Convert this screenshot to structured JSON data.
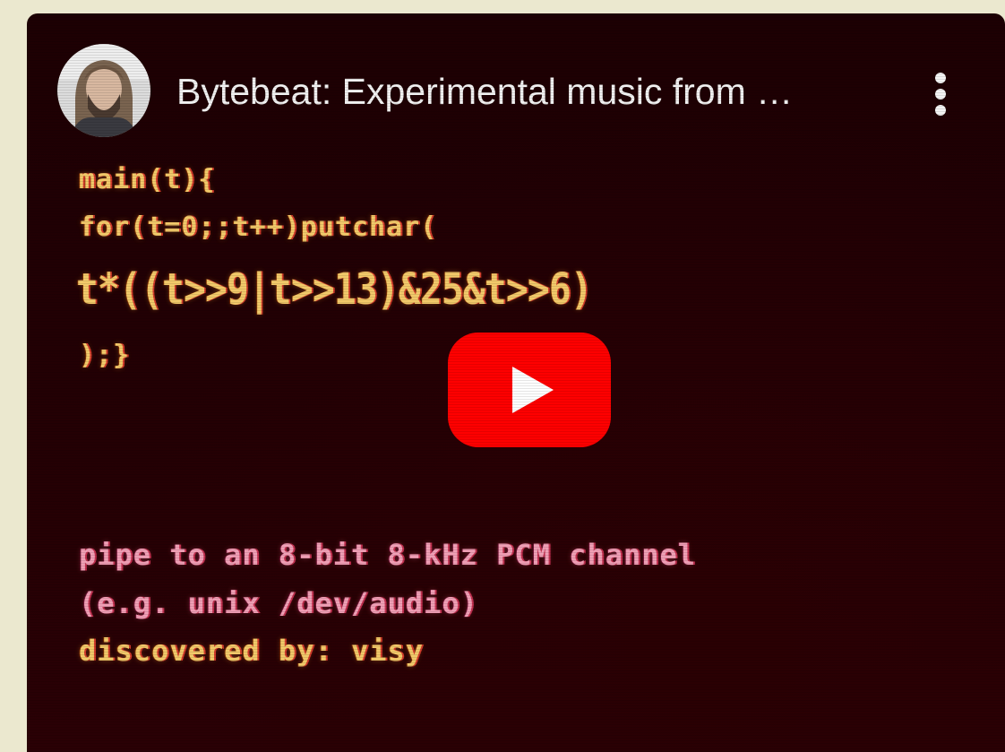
{
  "video": {
    "title": "Bytebeat: Experimental music from …",
    "channel_avatar_icon": "channel-avatar",
    "menu_icon": "more-vert-icon",
    "play_icon": "youtube-play-icon"
  },
  "thumbnail": {
    "code_lines": [
      "main(t){",
      "for(t=0;;t++)putchar(",
      "t*((t>>9|t>>13)&25&t>>6)",
      ");}"
    ],
    "caption_lines": [
      "pipe to an 8-bit 8-kHz PCM channel",
      "(e.g. unix /dev/audio)",
      "discovered by: visy"
    ]
  },
  "colors": {
    "page_background": "#ebe8cf",
    "video_background": "#1d0003",
    "code_yellow": "#f2c96a",
    "code_pink": "#f09fb5",
    "play_red": "#ff0000"
  }
}
